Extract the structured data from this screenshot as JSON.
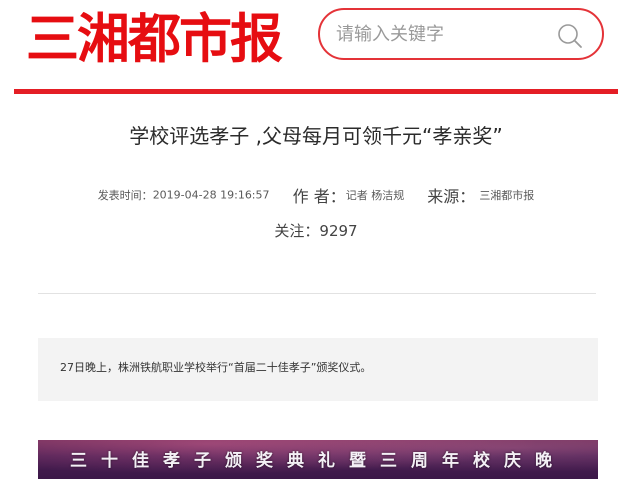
{
  "header": {
    "logo_text": "三湘都市报",
    "search": {
      "placeholder": "请输入关键字",
      "icon": "search-icon"
    }
  },
  "colors": {
    "brand_red": "#e60d11",
    "rule_red": "#e41e25",
    "summary_bg": "#f3f3f3"
  },
  "article": {
    "title": "学校评选孝子 ,父母每月可领千元“孝亲奖”",
    "meta": {
      "published_label": "发表时间：",
      "published_value": "2019-04-28 19:16:57",
      "author_label": "作 者：",
      "author_value": "记者 杨洁规",
      "source_label": "来源：",
      "source_value": "三湘都市报",
      "views_label": "关注：",
      "views_value": "9297"
    },
    "summary": "27日晚上，株洲铁航职业学校举行“首届二十佳孝子”颁奖仪式。",
    "photo_banner": "三十佳孝子颁奖典礼暨三周年校庆晚"
  }
}
